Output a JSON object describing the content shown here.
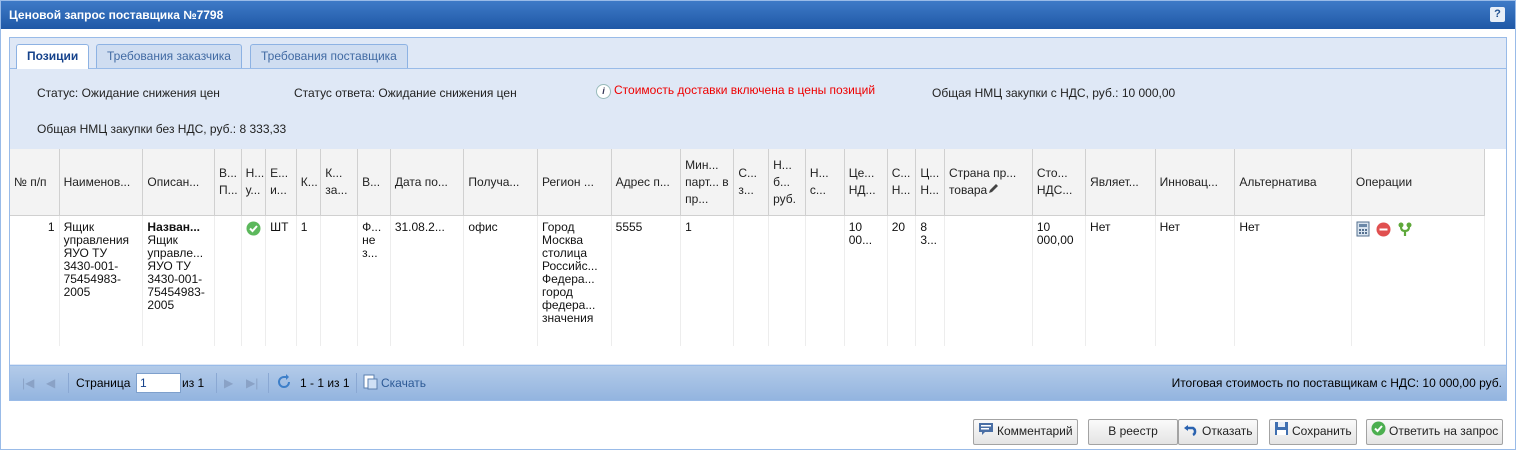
{
  "window": {
    "title": "Ценовой запрос поставщика №7798",
    "help": "?"
  },
  "tabs": [
    {
      "label": "Позиции"
    },
    {
      "label": "Требования заказчика"
    },
    {
      "label": "Требования поставщика"
    }
  ],
  "info": {
    "status": "Статус: Ожидание снижения цен",
    "response_status": "Статус ответа: Ожидание снижения цен",
    "delivery_note": "Стоимость доставки включена в цены позиций",
    "nmc_with_vat": "Общая НМЦ закупки с НДС, руб.: 10 000,00",
    "nmc_without_vat": "Общая НМЦ закупки без НДС, руб.: 8 333,33"
  },
  "grid": {
    "headers": [
      "№ п/п",
      "Наименов...",
      "Описан...",
      "В... П...",
      "Н... у...",
      "Е... и...",
      "К...",
      "К... за...",
      "В...",
      "Дата по...",
      "Получа...",
      "Регион ...",
      "Адрес п...",
      "Мин... парт... в пр...",
      "С... з...",
      "Н... б... руб.",
      "Н... с...",
      "Це... НД...",
      "С... Н...",
      "Ц... Н...",
      "Страна пр... товара",
      "Сто... НДС...",
      "Являет...",
      "Инновац...",
      "Альтернатива",
      "Операции"
    ],
    "row": {
      "num": "1",
      "name": "Ящик управления ЯУО ТУ 3430-001-75454983-2005",
      "desc_title": "Назван...",
      "desc": "Ящик управле... ЯУО ТУ 3430-001-75454983-2005",
      "unit": "ШТ",
      "qty": "1",
      "type": "Ф... не з...",
      "date": "31.08.2...",
      "receiver": "офис",
      "region": "Город Москва столица Российс... Федера... город федера... значения",
      "address": "5555",
      "min_batch": "1",
      "price_vat": "10 00...",
      "vat_rate": "20",
      "price_novat": "8 3...",
      "cost_vat": "10 000,00",
      "is": "Нет",
      "innov": "Нет",
      "alt": "Нет"
    }
  },
  "pager": {
    "page_label": "Страница",
    "page_value": "1",
    "of_label": "из 1",
    "range": "1 - 1 из 1",
    "download": "Скачать",
    "total": "Итоговая стоимость по поставщикам с НДС: 10 000,00 руб."
  },
  "buttons": {
    "comment": "Комментарий",
    "registry": "В реестр",
    "decline": "Отказать",
    "save": "Сохранить",
    "reply": "Ответить на запрос"
  },
  "colors": {
    "title_bg": "#2b63b0",
    "panel_bg": "#dfe8f6",
    "note_red": "#ee0000",
    "accent_green": "#4caf50"
  }
}
